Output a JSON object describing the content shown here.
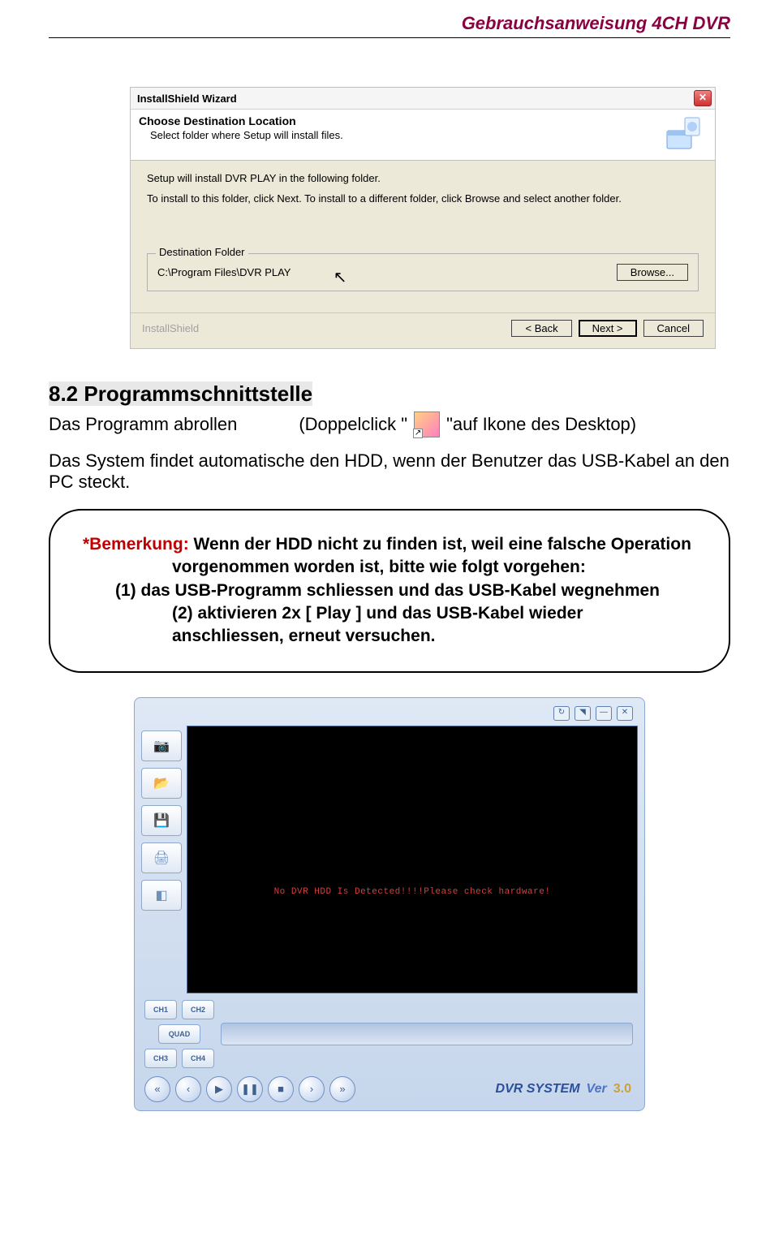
{
  "header": "Gebrauchsanweisung   4CH DVR",
  "dialog": {
    "title": "InstallShield Wizard",
    "head1": "Choose Destination Location",
    "head2": "Select folder where Setup will install files.",
    "body1": "Setup will install DVR PLAY in the following folder.",
    "body2": "To install to this folder, click Next. To install to a different folder, click Browse and select another folder.",
    "dest_legend": "Destination Folder",
    "dest_path": "C:\\Program Files\\DVR PLAY",
    "browse": "Browse...",
    "brand": "InstallShield",
    "back": "< Back",
    "next": "Next >",
    "cancel": "Cancel"
  },
  "section": {
    "title": "8.2 Programmschnittstelle",
    "line_a": "Das Programm abrollen",
    "line_b1": "(Doppelclick \"",
    "line_b2": "\"auf Ikone des Desktop)",
    "body": "Das System findet automatische den HDD, wenn der Benutzer das USB-Kabel an den PC steckt."
  },
  "note": {
    "bem": "*Bemerkung:",
    "l1": " Wenn der HDD nicht zu finden ist, weil eine falsche Operation",
    "l2": "vorgenommen worden ist, bitte wie folgt vorgehen:",
    "l3": "(1) das USB-Programm schliessen und das USB-Kabel wegnehmen",
    "l4": "(2) aktivieren 2x [ Play ] und das USB-Kabel wieder anschliessen, erneut versuchen."
  },
  "player": {
    "error": "No DVR HDD Is Detected!!!!Please check hardware!",
    "ch1": "CH1",
    "ch2": "CH2",
    "ch3": "CH3",
    "ch4": "CH4",
    "quad": "QUAD",
    "brand": "DVR SYSTEM",
    "ver_label": "Ver",
    "ver": "3.0"
  }
}
